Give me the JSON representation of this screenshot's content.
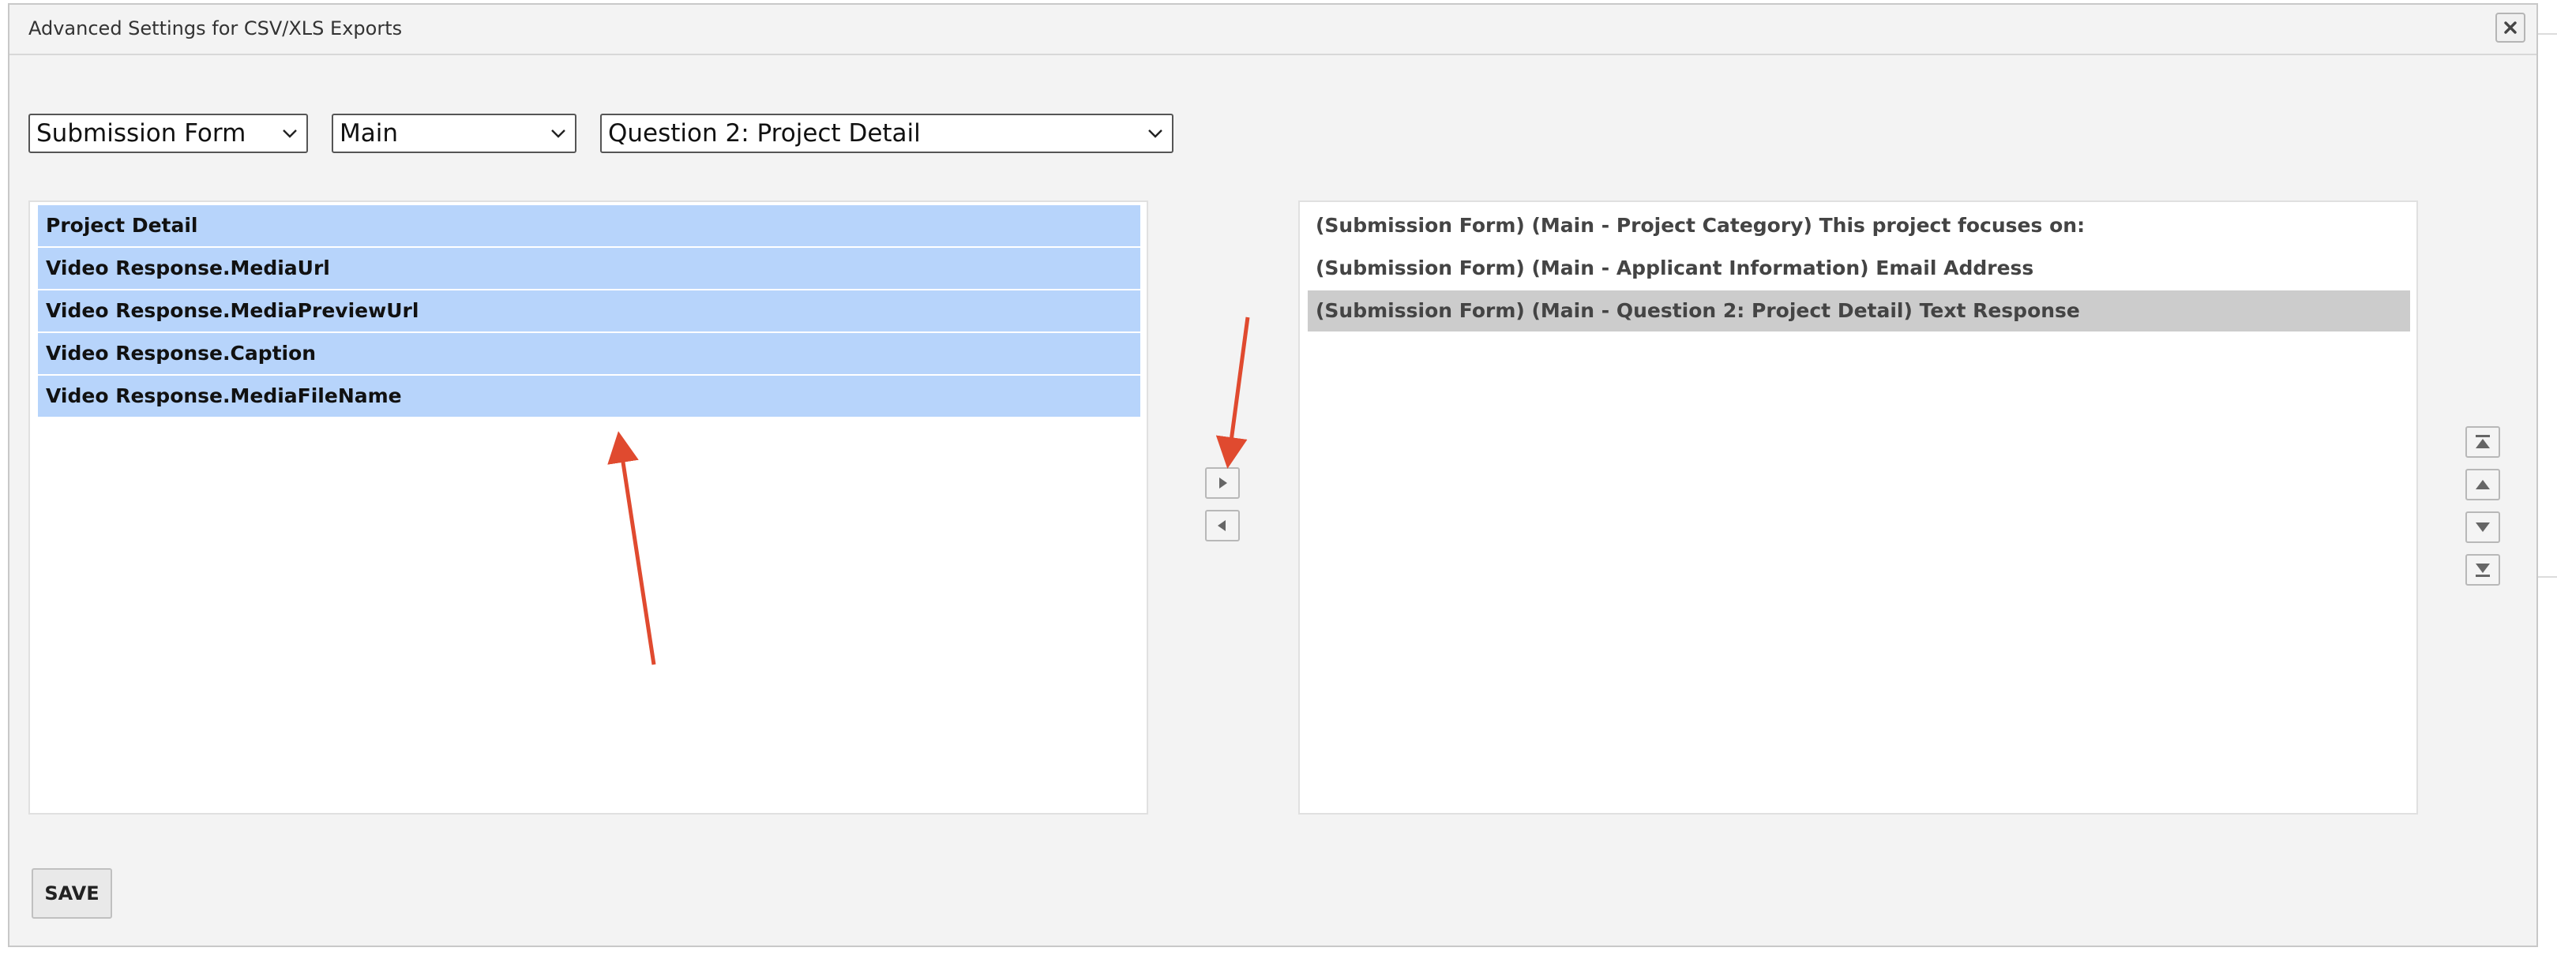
{
  "dialog": {
    "title": "Advanced Settings for CSV/XLS Exports"
  },
  "filters": {
    "form": "Submission Form",
    "section": "Main",
    "question": "Question 2: Project Detail"
  },
  "available_fields": [
    {
      "label": "Project Detail",
      "selected": true
    },
    {
      "label": "Video Response.MediaUrl",
      "selected": true
    },
    {
      "label": "Video Response.MediaPreviewUrl",
      "selected": true
    },
    {
      "label": "Video Response.Caption",
      "selected": true
    },
    {
      "label": "Video Response.MediaFileName",
      "selected": true
    }
  ],
  "export_fields": [
    {
      "label": "(Submission Form) (Main - Project Category) This project focuses on:",
      "selected": false
    },
    {
      "label": "(Submission Form) (Main - Applicant Information) Email Address",
      "selected": false
    },
    {
      "label": "(Submission Form) (Main - Question 2: Project Detail) Text Response",
      "selected": true
    }
  ],
  "buttons": {
    "save": "SAVE"
  },
  "icons": {
    "close": "close-icon",
    "move_right": "triangle-right-icon",
    "move_left": "triangle-left-icon",
    "move_top": "move-to-top-icon",
    "move_up": "triangle-up-icon",
    "move_down": "triangle-down-icon",
    "move_bottom": "move-to-bottom-icon"
  },
  "colors": {
    "selected_available": "#b7d4fb",
    "selected_export": "#cccccc",
    "annotation_arrow": "#e04a2f"
  }
}
